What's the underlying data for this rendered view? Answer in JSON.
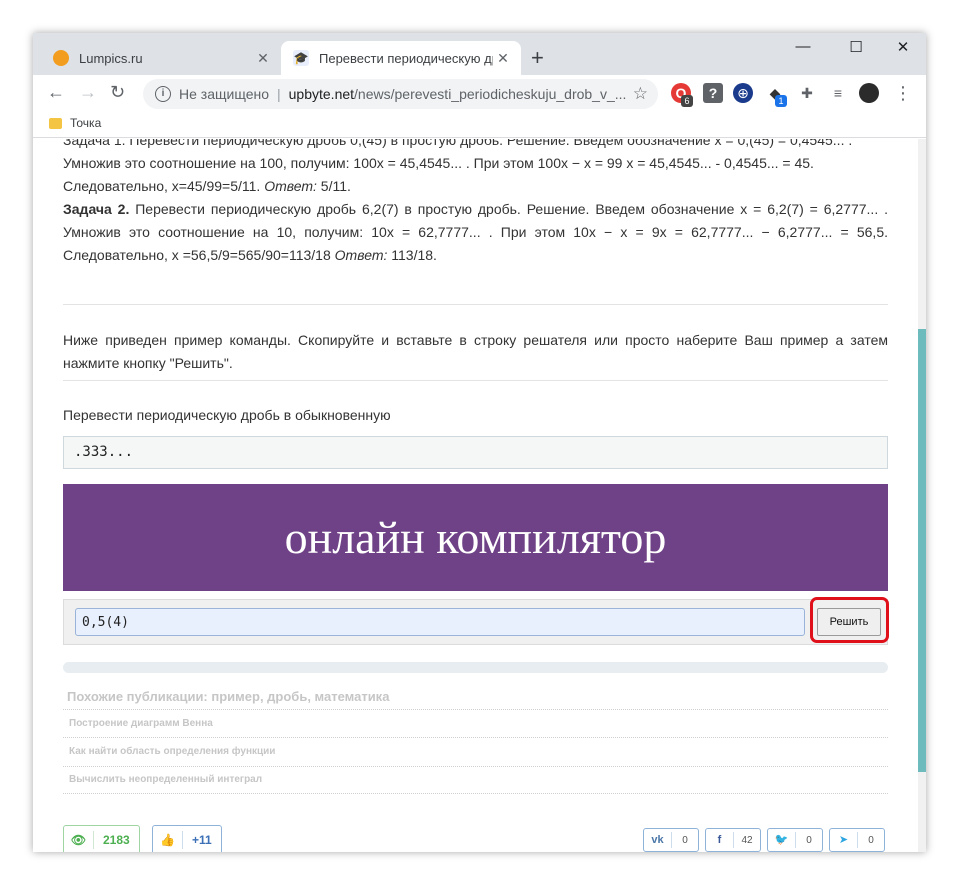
{
  "browser": {
    "tabs": [
      {
        "label": "Lumpics.ru",
        "active": false
      },
      {
        "label": "Перевести периодическую дробь",
        "active": true
      }
    ],
    "new_tab": "+",
    "controls": {
      "minimize": "—",
      "maximize": "☐",
      "close": "✕"
    },
    "address": {
      "security_text": "Не защищено",
      "host": "upbyte.net",
      "path": "/news/perevesti_periodicheskuju_drob_v_..."
    },
    "extensions": {
      "opera_badge": "6",
      "unknown_glyph": "?",
      "box_badge": "1"
    },
    "bookmark": "Точка"
  },
  "page": {
    "para_top_partial": "Задача 1. Перевести периодическую дробь 0,(45) в простую дробь. Решение. Введем обозначение x = 0,(45) = 0,4545... .",
    "para_line2": "Умножив это соотношение на 100, получим: 100x = 45,4545... . При этом 100x − x = 99 x = 45,4545... - 0,4545... = 45.",
    "para_line3_a": "Следовательно, x=45/99=5/11. ",
    "para_line3_answer_label": "Ответ:",
    "para_line3_b": " 5/11.",
    "task2_label": "Задача 2.",
    "task2_text": " Перевести периодическую дробь 6,2(7) в простую дробь. Решение. Введем обозначение x = 6,2(7) = 6,2777... . Умножив это соотношение на 10, получим: 10x = 62,7777... . При этом 10x − x = 9x = 62,7777... − 6,2777... = 56,5. Следовательно, x =56,5/9=565/90=113/18 ",
    "task2_answer_label": "Ответ:",
    "task2_answer": " 113/18.",
    "instruction": "Ниже приведен пример команды. Скопируйте и вставьте в строку решателя или просто наберите Ваш пример а затем нажмите кнопку \"Решить\".",
    "example_label": "Перевести периодическую дробь в обыкновенную",
    "example_code": ".333...",
    "banner_text": "онлайн компилятор",
    "solver_input": "0,5(4)",
    "solve_button": "Решить",
    "similar_heading": "Похожие публикации: пример, дробь, математика",
    "similar_items": [
      "Построение диаграмм Венна",
      "Как найти область определения функции",
      "Вычислить неопределенный интеграл"
    ],
    "views": "2183",
    "likes": "+11",
    "shares": {
      "vk": "0",
      "fb": "42",
      "tw": "0",
      "tg": "0"
    }
  },
  "colors": {
    "banner": "#6f4287",
    "highlight": "#e0101a",
    "views_green": "#4caf50",
    "likes_blue": "#3b6fb6"
  }
}
